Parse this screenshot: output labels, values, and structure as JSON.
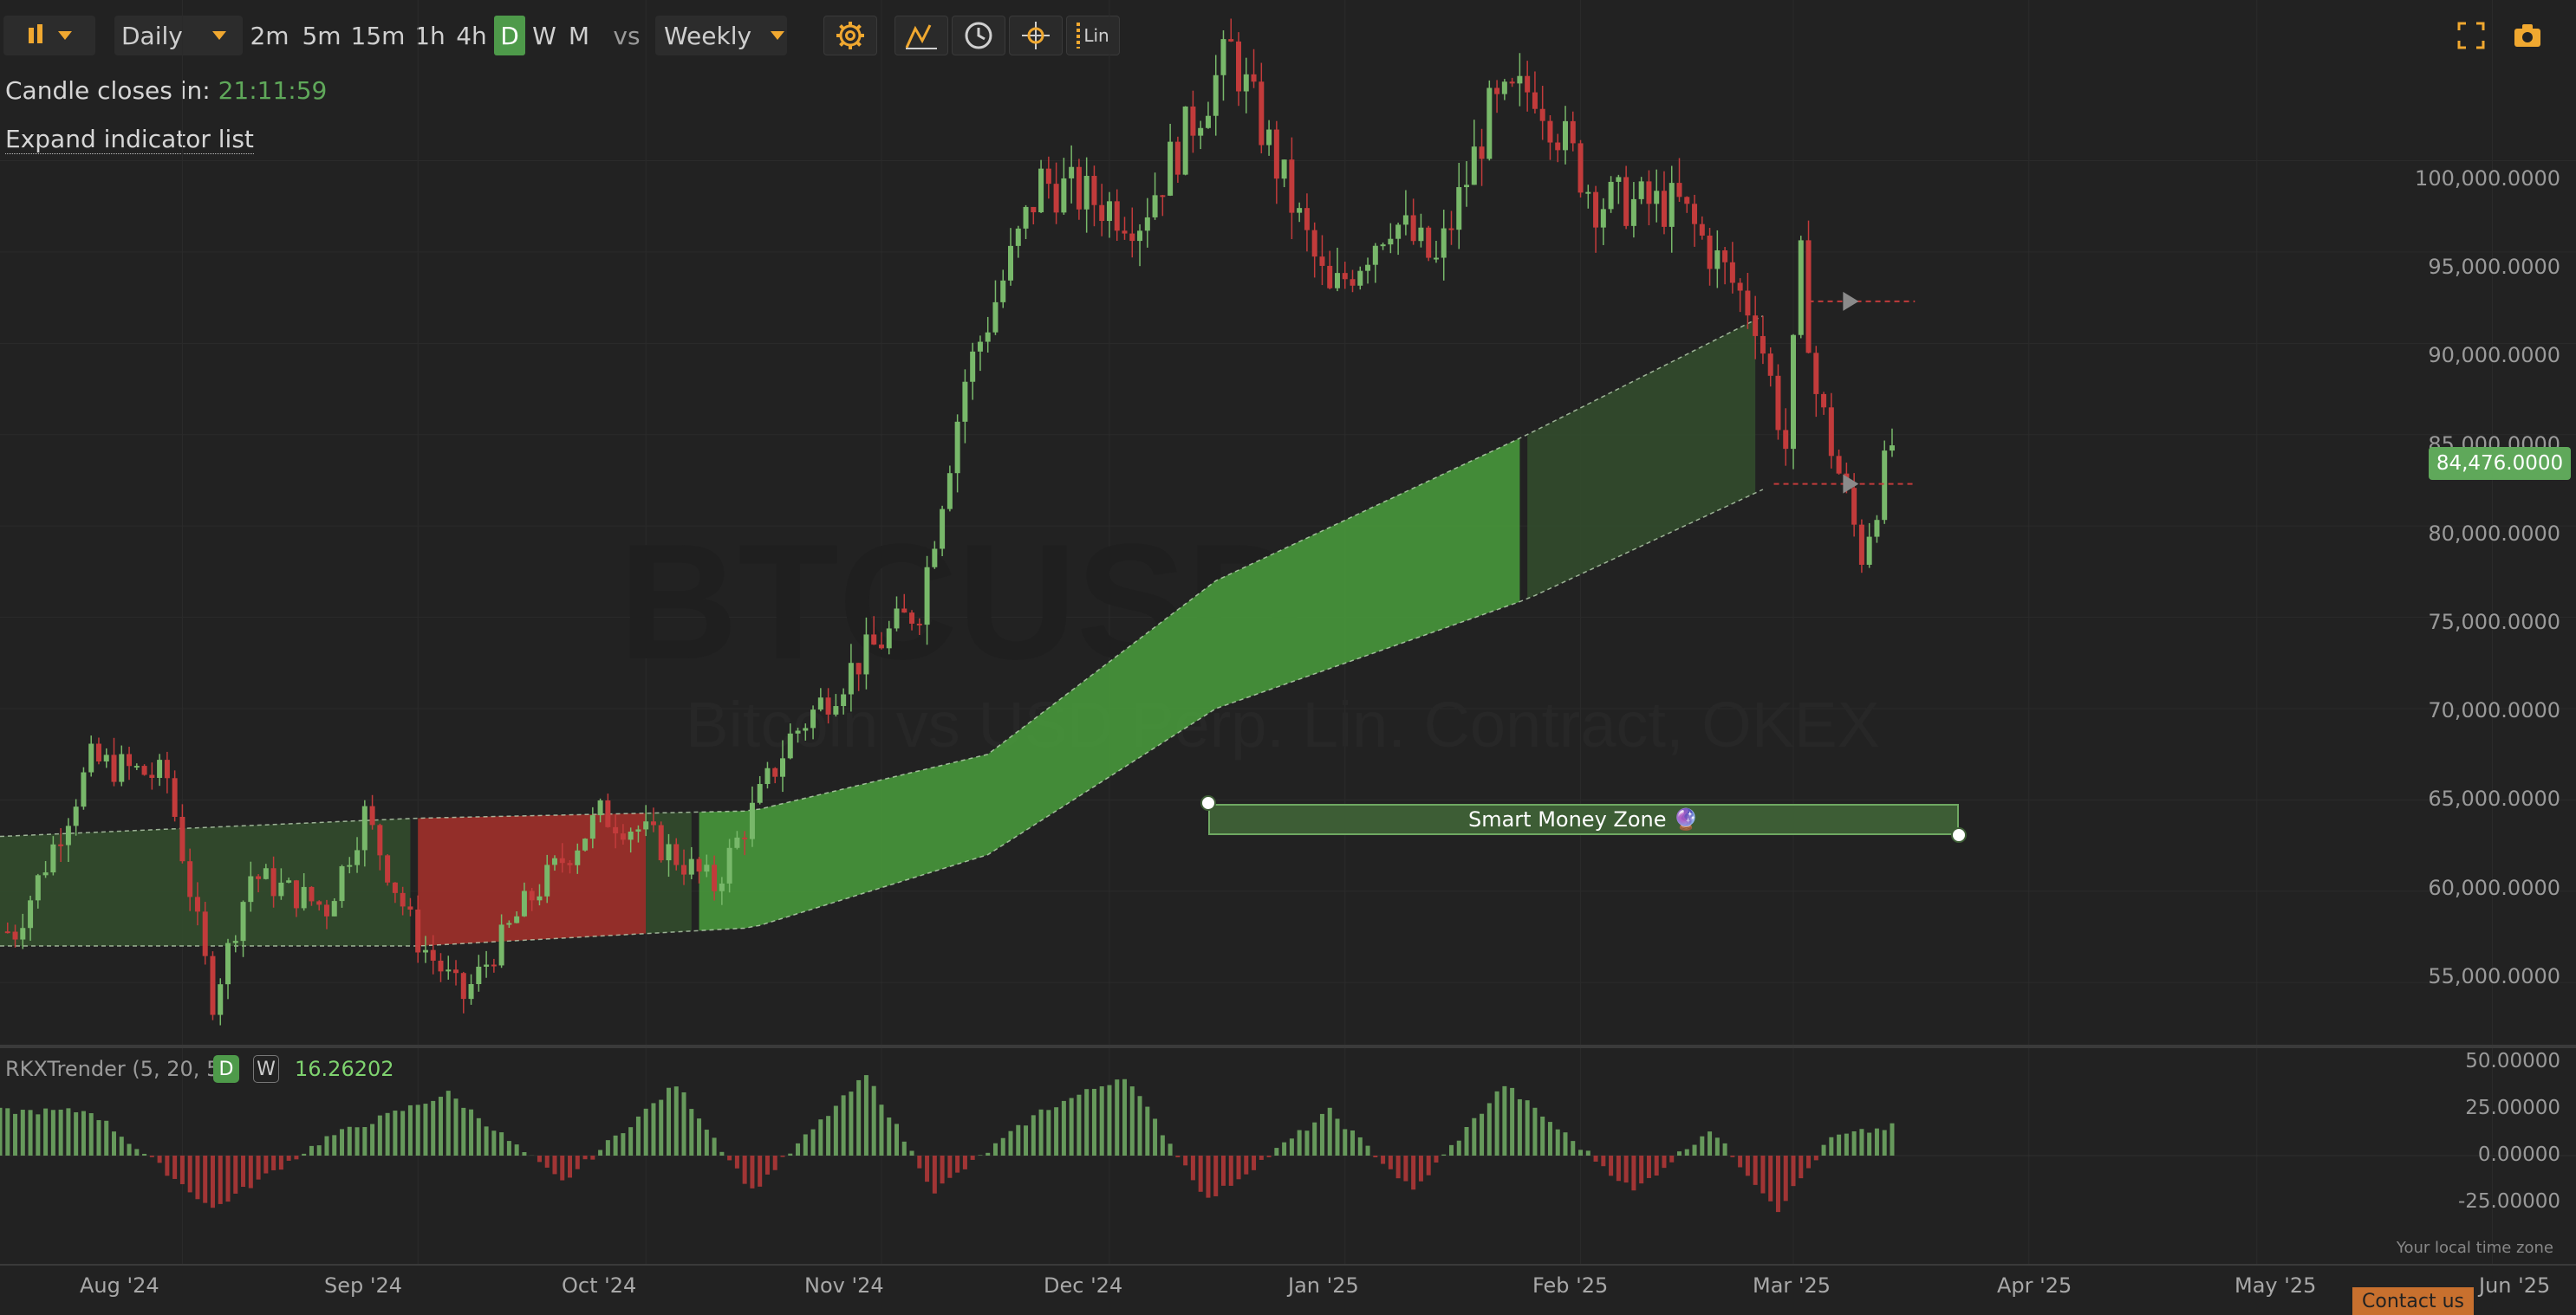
{
  "toolbar": {
    "timeframe": "Daily",
    "intervals": [
      "2m",
      "5m",
      "15m",
      "1h",
      "4h",
      "D",
      "W",
      "M"
    ],
    "active_interval": "D",
    "vs_label": "vs",
    "compare_timeframe": "Weekly",
    "scale_label": "Lin"
  },
  "info": {
    "candle_close_label": "Candle closes in:",
    "candle_close_time": "21:11:59",
    "expand_label": "Expand indicator list"
  },
  "watermark": {
    "symbol": "BTCUSD",
    "description": "Bitcoin vs USD Perp. Lin. Contract, OKEX"
  },
  "annotation": {
    "label": "Smart Money Zone 🔮"
  },
  "price_axis": {
    "ticks": [
      "100,000.0000",
      "95,000.0000",
      "90,000.0000",
      "85,000.0000",
      "80,000.0000",
      "75,000.0000",
      "70,000.0000",
      "65,000.0000",
      "60,000.0000",
      "55,000.0000"
    ],
    "last_price": "84,476.0000"
  },
  "indicator": {
    "name": "RKXTrender (5, 20, 5)",
    "tf_d": "D",
    "tf_w": "W",
    "value": "16.26202",
    "ticks": [
      "50.00000",
      "25.00000",
      "0.00000",
      "-25.00000"
    ]
  },
  "time_axis": {
    "labels": [
      "Aug '24",
      "Sep '24",
      "Oct '24",
      "Nov '24",
      "Dec '24",
      "Jan '25",
      "Feb '25",
      "Mar '25",
      "Apr '25",
      "May '25",
      "Jun '25"
    ]
  },
  "footer": {
    "local_time": "Your local time zone",
    "contact": "Contact us"
  },
  "colors": {
    "background": "#222222",
    "bull": "#78b86a",
    "bear": "#c23b3b",
    "zone_green": "#46913a",
    "zone_red": "#9a2f2a",
    "accent": "#f0a830",
    "countdown": "#5fa85a"
  },
  "chart_data": {
    "type": "candlestick",
    "symbol": "BTCUSD",
    "x_range": [
      "2024-07-08",
      "2025-06-12"
    ],
    "y_range": [
      51500,
      108800
    ],
    "closes": [
      [
        "2024-07-10",
        57800
      ],
      [
        "2024-07-20",
        67100
      ],
      [
        "2024-07-30",
        66200
      ],
      [
        "2024-08-05",
        54000
      ],
      [
        "2024-08-10",
        60900
      ],
      [
        "2024-08-20",
        59100
      ],
      [
        "2024-08-25",
        64200
      ],
      [
        "2024-09-01",
        57300
      ],
      [
        "2024-09-07",
        54200
      ],
      [
        "2024-09-15",
        59200
      ],
      [
        "2024-09-25",
        64200
      ],
      [
        "2024-09-30",
        63400
      ],
      [
        "2024-10-10",
        60300
      ],
      [
        "2024-10-20",
        68400
      ],
      [
        "2024-10-29",
        72600
      ],
      [
        "2024-11-06",
        75600
      ],
      [
        "2024-11-12",
        88000
      ],
      [
        "2024-11-22",
        98900
      ],
      [
        "2024-12-05",
        96900
      ],
      [
        "2024-12-17",
        106000
      ],
      [
        "2024-12-30",
        92500
      ],
      [
        "2025-01-07",
        96900
      ],
      [
        "2025-01-13",
        94300
      ],
      [
        "2025-01-20",
        102500
      ],
      [
        "2025-01-26",
        104100
      ],
      [
        "2025-02-03",
        97800
      ],
      [
        "2025-02-14",
        97500
      ],
      [
        "2025-02-24",
        91500
      ],
      [
        "2025-02-28",
        84300
      ],
      [
        "2025-03-02",
        94300
      ],
      [
        "2025-03-04",
        87300
      ],
      [
        "2025-03-10",
        78500
      ],
      [
        "2025-03-14",
        84476
      ]
    ],
    "last_price": 84476,
    "band": {
      "upper": [
        [
          "2024-07-08",
          63000
        ],
        [
          "2024-09-01",
          64000
        ],
        [
          "2024-10-15",
          64400
        ],
        [
          "2024-11-15",
          67500
        ],
        [
          "2024-12-15",
          77000
        ],
        [
          "2025-01-25",
          85000
        ],
        [
          "2025-02-25",
          91500
        ]
      ],
      "lower": [
        [
          "2024-07-08",
          57000
        ],
        [
          "2024-09-01",
          57000
        ],
        [
          "2024-10-15",
          58000
        ],
        [
          "2024-11-15",
          62000
        ],
        [
          "2024-12-15",
          70000
        ],
        [
          "2025-01-25",
          76000
        ],
        [
          "2025-02-25",
          82000
        ]
      ]
    },
    "indicator_series": [
      [
        "2024-07-20",
        25
      ],
      [
        "2024-08-05",
        -30
      ],
      [
        "2024-08-20",
        10
      ],
      [
        "2024-09-05",
        35
      ],
      [
        "2024-09-20",
        -15
      ],
      [
        "2024-10-05",
        40
      ],
      [
        "2024-10-15",
        -20
      ],
      [
        "2024-10-30",
        45
      ],
      [
        "2024-11-08",
        -20
      ],
      [
        "2024-11-22",
        25
      ],
      [
        "2024-12-03",
        45
      ],
      [
        "2024-12-14",
        -25
      ],
      [
        "2024-12-30",
        25
      ],
      [
        "2025-01-10",
        -20
      ],
      [
        "2025-01-22",
        40
      ],
      [
        "2025-02-08",
        -20
      ],
      [
        "2025-02-18",
        15
      ],
      [
        "2025-02-27",
        -30
      ],
      [
        "2025-03-06",
        10
      ],
      [
        "2025-03-14",
        16.26202
      ]
    ]
  }
}
